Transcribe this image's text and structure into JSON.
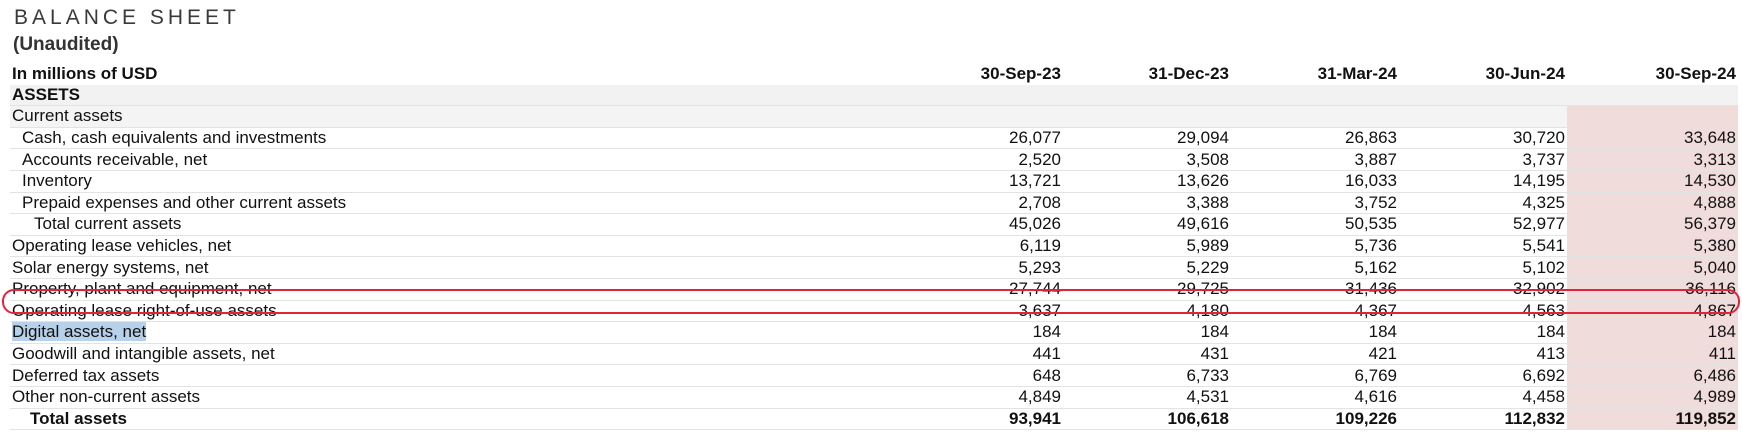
{
  "title": "BALANCE SHEET",
  "subtitle": "(Unaudited)",
  "units_label": "In millions of USD",
  "periods": [
    "30-Sep-23",
    "31-Dec-23",
    "31-Mar-24",
    "30-Jun-24",
    "30-Sep-24"
  ],
  "highlight_color": "#f1dcdc",
  "circle_color": "#e2233a",
  "selected_row": "Digital assets, net",
  "sections": {
    "assets": "ASSETS",
    "current_assets": "Current assets"
  },
  "rows": [
    {
      "label": "Cash, cash equivalents and investments",
      "values": [
        "26,077",
        "29,094",
        "26,863",
        "30,720",
        "33,648"
      ]
    },
    {
      "label": "Accounts receivable, net",
      "values": [
        "2,520",
        "3,508",
        "3,887",
        "3,737",
        "3,313"
      ]
    },
    {
      "label": "Inventory",
      "values": [
        "13,721",
        "13,626",
        "16,033",
        "14,195",
        "14,530"
      ]
    },
    {
      "label": "Prepaid expenses and other current assets",
      "values": [
        "2,708",
        "3,388",
        "3,752",
        "4,325",
        "4,888"
      ]
    },
    {
      "label": "Total current assets",
      "values": [
        "45,026",
        "49,616",
        "50,535",
        "52,977",
        "56,379"
      ]
    },
    {
      "label": "Operating lease vehicles, net",
      "values": [
        "6,119",
        "5,989",
        "5,736",
        "5,541",
        "5,380"
      ]
    },
    {
      "label": "Solar energy systems, net",
      "values": [
        "5,293",
        "5,229",
        "5,162",
        "5,102",
        "5,040"
      ]
    },
    {
      "label": "Property, plant and equipment, net",
      "values": [
        "27,744",
        "29,725",
        "31,436",
        "32,902",
        "36,116"
      ]
    },
    {
      "label": "Operating lease right-of-use assets",
      "values": [
        "3,637",
        "4,180",
        "4,367",
        "4,563",
        "4,867"
      ]
    },
    {
      "label": "Digital assets, net",
      "values": [
        "184",
        "184",
        "184",
        "184",
        "184"
      ]
    },
    {
      "label": "Goodwill and intangible assets, net",
      "values": [
        "441",
        "431",
        "421",
        "413",
        "411"
      ]
    },
    {
      "label": "Deferred tax assets",
      "values": [
        "648",
        "6,733",
        "6,769",
        "6,692",
        "6,486"
      ]
    },
    {
      "label": "Other non-current assets",
      "values": [
        "4,849",
        "4,531",
        "4,616",
        "4,458",
        "4,989"
      ]
    },
    {
      "label": "Total assets",
      "values": [
        "93,941",
        "106,618",
        "109,226",
        "112,832",
        "119,852"
      ]
    }
  ]
}
